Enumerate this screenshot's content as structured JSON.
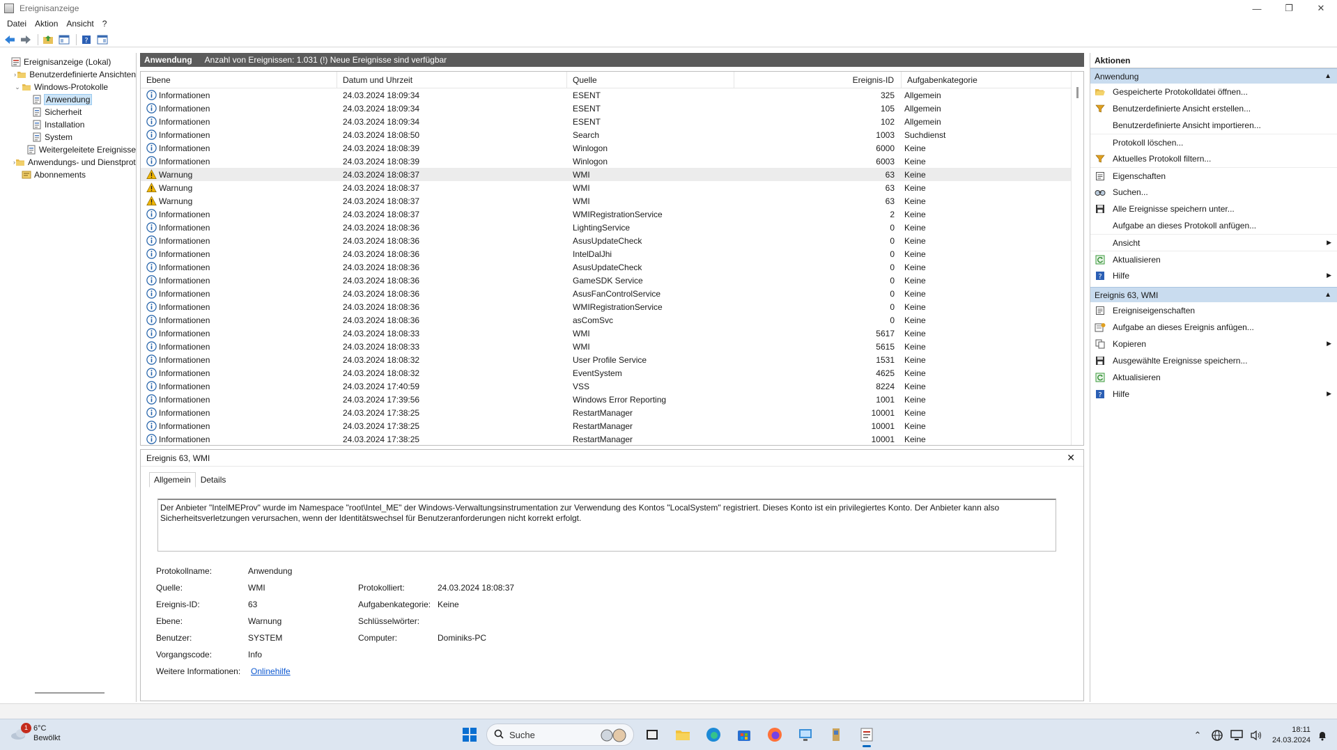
{
  "window": {
    "title": "Ereignisanzeige",
    "min_icon": "minimize-icon",
    "max_icon": "maximize-icon",
    "close_icon": "close-icon"
  },
  "menu": [
    "Datei",
    "Aktion",
    "Ansicht",
    "?"
  ],
  "tree": [
    {
      "label": "Ereignisanzeige (Lokal)",
      "indent": 0,
      "expander": "",
      "icon": "event-viewer-icon"
    },
    {
      "label": "Benutzerdefinierte Ansichten",
      "indent": 1,
      "expander": "›",
      "icon": "folder-icon"
    },
    {
      "label": "Windows-Protokolle",
      "indent": 1,
      "expander": "⌄",
      "icon": "folder-icon"
    },
    {
      "label": "Anwendung",
      "indent": 2,
      "expander": "",
      "icon": "log-icon",
      "selected": true
    },
    {
      "label": "Sicherheit",
      "indent": 2,
      "expander": "",
      "icon": "log-icon"
    },
    {
      "label": "Installation",
      "indent": 2,
      "expander": "",
      "icon": "log-icon"
    },
    {
      "label": "System",
      "indent": 2,
      "expander": "",
      "icon": "log-icon"
    },
    {
      "label": "Weitergeleitete Ereignisse",
      "indent": 2,
      "expander": "",
      "icon": "log-icon"
    },
    {
      "label": "Anwendungs- und Dienstprotokolle",
      "indent": 1,
      "expander": "›",
      "icon": "folder-icon"
    },
    {
      "label": "Abonnements",
      "indent": 1,
      "expander": "",
      "icon": "subscription-icon"
    }
  ],
  "center": {
    "log_name": "Anwendung",
    "summary": "Anzahl von Ereignissen: 1.031 (!) Neue Ereignisse sind verfügbar"
  },
  "grid": {
    "columns": [
      "Ebene",
      "Datum und Uhrzeit",
      "Quelle",
      "Ereignis-ID",
      "Aufgabenkategorie"
    ],
    "rows": [
      {
        "level": "Informationen",
        "type": "info",
        "date": "24.03.2024 18:09:34",
        "source": "ESENT",
        "id": "325",
        "cat": "Allgemein"
      },
      {
        "level": "Informationen",
        "type": "info",
        "date": "24.03.2024 18:09:34",
        "source": "ESENT",
        "id": "105",
        "cat": "Allgemein"
      },
      {
        "level": "Informationen",
        "type": "info",
        "date": "24.03.2024 18:09:34",
        "source": "ESENT",
        "id": "102",
        "cat": "Allgemein"
      },
      {
        "level": "Informationen",
        "type": "info",
        "date": "24.03.2024 18:08:50",
        "source": "Search",
        "id": "1003",
        "cat": "Suchdienst"
      },
      {
        "level": "Informationen",
        "type": "info",
        "date": "24.03.2024 18:08:39",
        "source": "Winlogon",
        "id": "6000",
        "cat": "Keine"
      },
      {
        "level": "Informationen",
        "type": "info",
        "date": "24.03.2024 18:08:39",
        "source": "Winlogon",
        "id": "6003",
        "cat": "Keine"
      },
      {
        "level": "Warnung",
        "type": "warn",
        "date": "24.03.2024 18:08:37",
        "source": "WMI",
        "id": "63",
        "cat": "Keine",
        "selected": true
      },
      {
        "level": "Warnung",
        "type": "warn",
        "date": "24.03.2024 18:08:37",
        "source": "WMI",
        "id": "63",
        "cat": "Keine"
      },
      {
        "level": "Warnung",
        "type": "warn",
        "date": "24.03.2024 18:08:37",
        "source": "WMI",
        "id": "63",
        "cat": "Keine"
      },
      {
        "level": "Informationen",
        "type": "info",
        "date": "24.03.2024 18:08:37",
        "source": "WMIRegistrationService",
        "id": "2",
        "cat": "Keine"
      },
      {
        "level": "Informationen",
        "type": "info",
        "date": "24.03.2024 18:08:36",
        "source": "LightingService",
        "id": "0",
        "cat": "Keine"
      },
      {
        "level": "Informationen",
        "type": "info",
        "date": "24.03.2024 18:08:36",
        "source": "AsusUpdateCheck",
        "id": "0",
        "cat": "Keine"
      },
      {
        "level": "Informationen",
        "type": "info",
        "date": "24.03.2024 18:08:36",
        "source": "IntelDalJhi",
        "id": "0",
        "cat": "Keine"
      },
      {
        "level": "Informationen",
        "type": "info",
        "date": "24.03.2024 18:08:36",
        "source": "AsusUpdateCheck",
        "id": "0",
        "cat": "Keine"
      },
      {
        "level": "Informationen",
        "type": "info",
        "date": "24.03.2024 18:08:36",
        "source": "GameSDK Service",
        "id": "0",
        "cat": "Keine"
      },
      {
        "level": "Informationen",
        "type": "info",
        "date": "24.03.2024 18:08:36",
        "source": "AsusFanControlService",
        "id": "0",
        "cat": "Keine"
      },
      {
        "level": "Informationen",
        "type": "info",
        "date": "24.03.2024 18:08:36",
        "source": "WMIRegistrationService",
        "id": "0",
        "cat": "Keine"
      },
      {
        "level": "Informationen",
        "type": "info",
        "date": "24.03.2024 18:08:36",
        "source": "asComSvc",
        "id": "0",
        "cat": "Keine"
      },
      {
        "level": "Informationen",
        "type": "info",
        "date": "24.03.2024 18:08:33",
        "source": "WMI",
        "id": "5617",
        "cat": "Keine"
      },
      {
        "level": "Informationen",
        "type": "info",
        "date": "24.03.2024 18:08:33",
        "source": "WMI",
        "id": "5615",
        "cat": "Keine"
      },
      {
        "level": "Informationen",
        "type": "info",
        "date": "24.03.2024 18:08:32",
        "source": "User Profile Service",
        "id": "1531",
        "cat": "Keine"
      },
      {
        "level": "Informationen",
        "type": "info",
        "date": "24.03.2024 18:08:32",
        "source": "EventSystem",
        "id": "4625",
        "cat": "Keine"
      },
      {
        "level": "Informationen",
        "type": "info",
        "date": "24.03.2024 17:40:59",
        "source": "VSS",
        "id": "8224",
        "cat": "Keine"
      },
      {
        "level": "Informationen",
        "type": "info",
        "date": "24.03.2024 17:39:56",
        "source": "Windows Error Reporting",
        "id": "1001",
        "cat": "Keine"
      },
      {
        "level": "Informationen",
        "type": "info",
        "date": "24.03.2024 17:38:25",
        "source": "RestartManager",
        "id": "10001",
        "cat": "Keine"
      },
      {
        "level": "Informationen",
        "type": "info",
        "date": "24.03.2024 17:38:25",
        "source": "RestartManager",
        "id": "10001",
        "cat": "Keine"
      },
      {
        "level": "Informationen",
        "type": "info",
        "date": "24.03.2024 17:38:25",
        "source": "RestartManager",
        "id": "10001",
        "cat": "Keine"
      }
    ]
  },
  "detail": {
    "title": "Ereignis 63, WMI",
    "tabs": [
      "Allgemein",
      "Details"
    ],
    "description": "Der Anbieter \"IntelMEProv\" wurde im Namespace \"root\\Intel_ME\" der Windows-Verwaltungsinstrumentation zur Verwendung des Kontos \"LocalSystem\" registriert. Dieses Konto ist ein privilegiertes Konto. Der Anbieter kann also Sicherheitsverletzungen verursachen, wenn der Identitätswechsel für Benutzeranforderungen nicht korrekt erfolgt.",
    "props": {
      "log_label": "Protokollname:",
      "log_value": "Anwendung",
      "source_label": "Quelle:",
      "source_value": "WMI",
      "logged_label": "Protokolliert:",
      "logged_value": "24.03.2024 18:08:37",
      "id_label": "Ereignis-ID:",
      "id_value": "63",
      "task_label": "Aufgabenkategorie:",
      "task_value": "Keine",
      "level_label": "Ebene:",
      "level_value": "Warnung",
      "keywords_label": "Schlüsselwörter:",
      "keywords_value": "",
      "user_label": "Benutzer:",
      "user_value": "SYSTEM",
      "computer_label": "Computer:",
      "computer_value": "Dominiks-PC",
      "opcode_label": "Vorgangscode:",
      "opcode_value": "Info",
      "more_label": "Weitere Informationen:",
      "more_link": "Onlinehilfe"
    }
  },
  "actions": {
    "title": "Aktionen",
    "section1": "Anwendung",
    "items1": [
      {
        "label": "Gespeicherte Protokolldatei öffnen...",
        "icon": "open-folder-icon"
      },
      {
        "label": "Benutzerdefinierte Ansicht erstellen...",
        "icon": "filter-icon"
      },
      {
        "label": "Benutzerdefinierte Ansicht importieren...",
        "icon": ""
      },
      {
        "label": "Protokoll löschen...",
        "icon": "",
        "sep": true
      },
      {
        "label": "Aktuelles Protokoll filtern...",
        "icon": "filter-icon"
      },
      {
        "label": "Eigenschaften",
        "icon": "properties-icon",
        "sep": true
      },
      {
        "label": "Suchen...",
        "icon": "find-icon"
      },
      {
        "label": "Alle Ereignisse speichern unter...",
        "icon": "save-icon"
      },
      {
        "label": "Aufgabe an dieses Protokoll anfügen...",
        "icon": ""
      },
      {
        "label": "Ansicht",
        "icon": "",
        "arrow": true,
        "sep": true
      },
      {
        "label": "Aktualisieren",
        "icon": "refresh-icon",
        "sep": true
      },
      {
        "label": "Hilfe",
        "icon": "help-icon",
        "arrow": true
      }
    ],
    "section2": "Ereignis 63, WMI",
    "items2": [
      {
        "label": "Ereigniseigenschaften",
        "icon": "properties-icon"
      },
      {
        "label": "Aufgabe an dieses Ereignis anfügen...",
        "icon": "task-icon"
      },
      {
        "label": "Kopieren",
        "icon": "copy-icon",
        "arrow": true
      },
      {
        "label": "Ausgewählte Ereignisse speichern...",
        "icon": "save-icon"
      },
      {
        "label": "Aktualisieren",
        "icon": "refresh-icon"
      },
      {
        "label": "Hilfe",
        "icon": "help-icon",
        "arrow": true
      }
    ]
  },
  "taskbar": {
    "temp": "6°C",
    "weather": "Bewölkt",
    "weather_badge": "1",
    "search_placeholder": "Suche",
    "time": "18:11",
    "date": "24.03.2024"
  },
  "colors": {
    "header_bg": "#5b5b5b",
    "section_bg": "#c9dcef",
    "info_icon": "#1f5fa8",
    "warn_icon": "#f2b600",
    "link": "#0b57d0"
  }
}
